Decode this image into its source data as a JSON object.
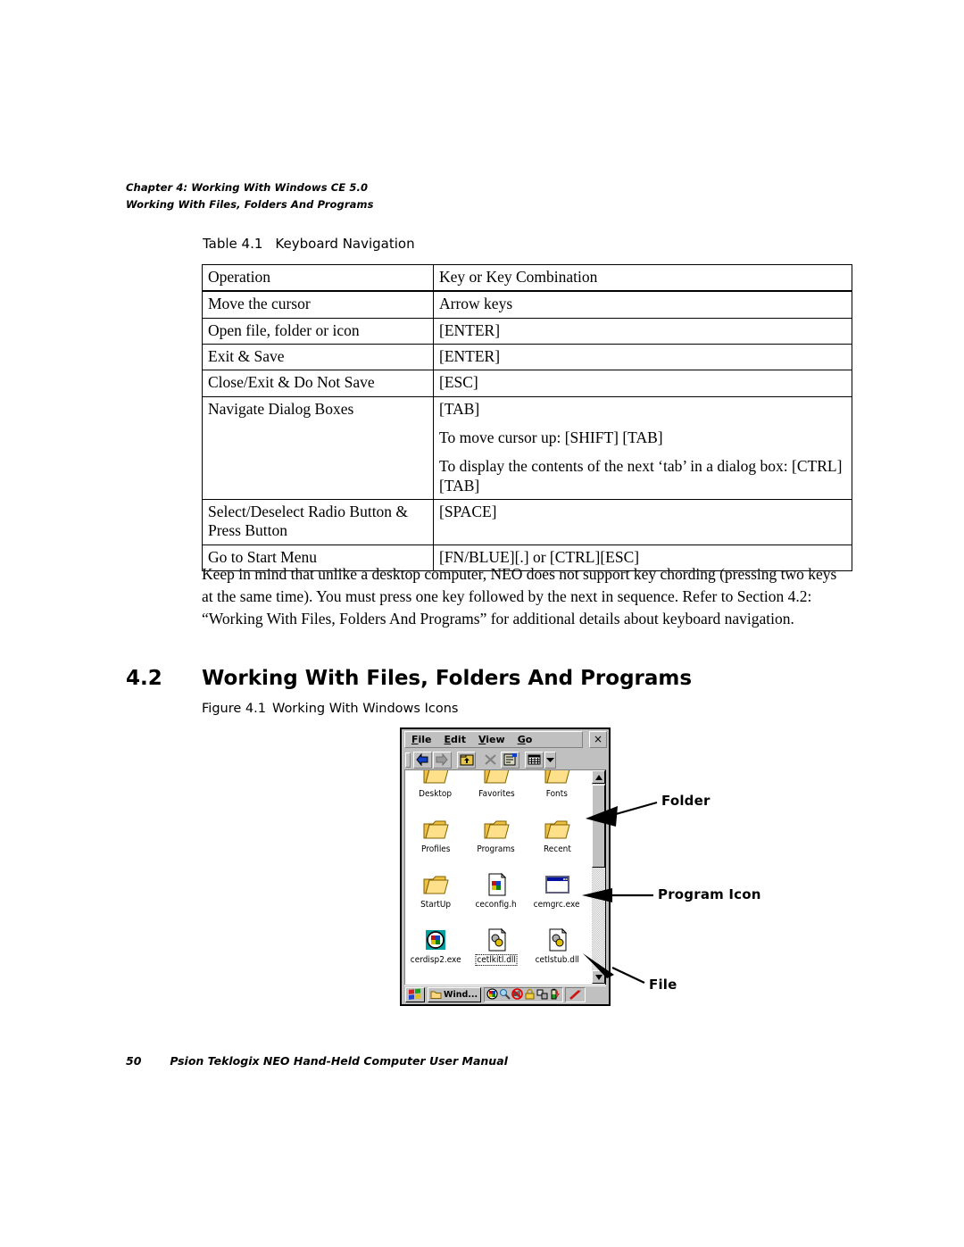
{
  "running_head": {
    "chapter": "Chapter 4:  Working With Windows CE 5.0",
    "section": "Working With Files, Folders And Programs"
  },
  "table_caption": {
    "number": "Table 4.1",
    "title": "Keyboard Navigation"
  },
  "table": {
    "headers": [
      "Operation",
      "Key or Key Combination"
    ],
    "rows": [
      {
        "operation": "Move the cursor",
        "key": "Arrow keys"
      },
      {
        "operation": "Open file, folder or icon",
        "key": "[ENTER]"
      },
      {
        "operation": "Exit & Save",
        "key": "[ENTER]"
      },
      {
        "operation": "Close/Exit & Do Not Save",
        "key": "[ESC]"
      },
      {
        "operation": "Navigate Dialog Boxes",
        "key": "[TAB]"
      },
      {
        "operation": "",
        "key": "To move cursor up: [SHIFT] [TAB]"
      },
      {
        "operation": "",
        "key": "To display the contents of the next ‘tab’ in a dialog box: [CTRL] [TAB]"
      },
      {
        "operation": "Select/Deselect Radio Button & Press Button",
        "key": "[SPACE]"
      },
      {
        "operation": "Go to Start Menu",
        "key": "[FN/BLUE][.] or [CTRL][ESC]"
      }
    ]
  },
  "paragraph": "Keep in mind that unlike a desktop computer, NEO does not support key chording (pressing two keys at the same time). You must press one key followed by the next in sequence. Refer to Section 4.2: “Working With Files, Folders And Programs” for additional details about keyboard navigation.",
  "section_heading": {
    "number": "4.2",
    "title": "Working With Files, Folders And Programs"
  },
  "figure_caption": {
    "number": "Figure 4.1",
    "title": "Working With Windows Icons"
  },
  "ce_window": {
    "menu": [
      {
        "label": "File",
        "accel": "F",
        "rest": "ile"
      },
      {
        "label": "Edit",
        "accel": "E",
        "rest": "dit"
      },
      {
        "label": "View",
        "accel": "V",
        "rest": "iew"
      },
      {
        "label": "Go",
        "accel": "G",
        "rest": "o"
      }
    ],
    "close_label": "×",
    "toolbar": [
      {
        "name": "back-icon",
        "title": "Back"
      },
      {
        "name": "forward-icon",
        "title": "Forward"
      },
      {
        "name": "up-one-level-icon",
        "title": "Up One Level"
      },
      {
        "name": "cut-icon",
        "title": "Cut"
      },
      {
        "name": "properties-icon",
        "title": "Properties"
      },
      {
        "name": "views-icon",
        "title": "Views"
      }
    ],
    "icons": [
      {
        "label": "Desktop",
        "type": "folder",
        "selected": false
      },
      {
        "label": "Favorites",
        "type": "folder",
        "selected": false
      },
      {
        "label": "Fonts",
        "type": "folder",
        "selected": false
      },
      {
        "label": "Profiles",
        "type": "folder",
        "selected": false
      },
      {
        "label": "Programs",
        "type": "folder",
        "selected": false
      },
      {
        "label": "Recent",
        "type": "folder",
        "selected": false
      },
      {
        "label": "StartUp",
        "type": "folder",
        "selected": false
      },
      {
        "label": "ceconfig.h",
        "type": "file-flag",
        "selected": false
      },
      {
        "label": "cemgrc.exe",
        "type": "program-window",
        "selected": false
      },
      {
        "label": "cerdisp2.exe",
        "type": "program-globe",
        "selected": false
      },
      {
        "label": "cetlkitl.dll",
        "type": "file-gear",
        "selected": true
      },
      {
        "label": "cetlstub.dll",
        "type": "file-gear",
        "selected": false
      }
    ],
    "taskbar": {
      "start_icon": "windows-flag-icon",
      "task_label": "Wind...",
      "tray_icons": [
        "network-globe-icon",
        "input-tool-icon",
        "sound-muted-icon",
        "lock-icon",
        "dock-icon",
        "battery-icon"
      ],
      "stylus_icon": "stylus-icon"
    }
  },
  "callouts": [
    {
      "label": "Folder"
    },
    {
      "label": "Program  Icon"
    },
    {
      "label": "File"
    }
  ],
  "footer": {
    "page_number": "50",
    "title": "Psion Teklogix NEO Hand-Held Computer User Manual"
  },
  "colors": {
    "chrome": "#c0c0c0",
    "window_bg": "#ffffff",
    "titlebar_blue": "#000080",
    "folder_yellow": "#ffcc66",
    "text": "#000000"
  }
}
